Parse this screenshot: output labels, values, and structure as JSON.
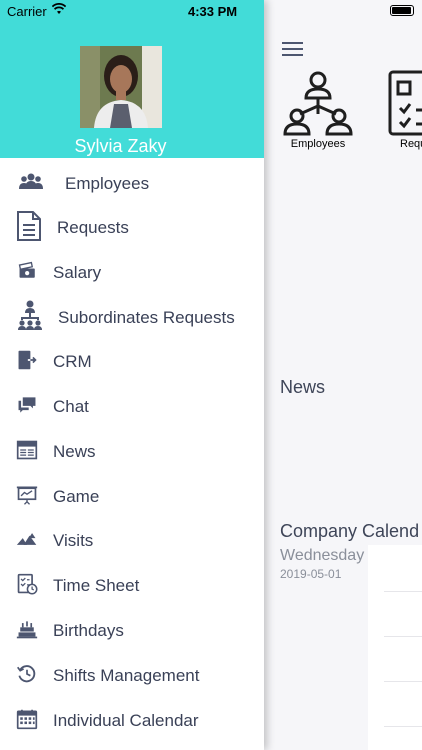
{
  "status_bar": {
    "carrier": "Carrier",
    "time": "4:33 PM"
  },
  "drawer": {
    "user_name": "Sylvia Zaky",
    "items": [
      {
        "label": "Employees",
        "icon": "employees-icon"
      },
      {
        "label": "Requests",
        "icon": "document-icon"
      },
      {
        "label": "Salary",
        "icon": "salary-icon"
      },
      {
        "label": "Subordinates Requests",
        "icon": "hierarchy-icon"
      },
      {
        "label": "CRM",
        "icon": "crm-icon"
      },
      {
        "label": "Chat",
        "icon": "chat-icon"
      },
      {
        "label": "News",
        "icon": "newspaper-icon"
      },
      {
        "label": "Game",
        "icon": "presentation-icon"
      },
      {
        "label": "Visits",
        "icon": "visits-icon"
      },
      {
        "label": "Time Sheet",
        "icon": "timesheet-icon"
      },
      {
        "label": "Birthdays",
        "icon": "cake-icon"
      },
      {
        "label": "Shifts Management",
        "icon": "shift-clock-icon"
      },
      {
        "label": "Individual Calendar",
        "icon": "calendar-icon"
      }
    ]
  },
  "main": {
    "tiles": [
      {
        "label": "Employees"
      },
      {
        "label": "Requ"
      }
    ],
    "news_heading": "News",
    "calendar": {
      "heading": "Company Calend",
      "day": "Wednesday",
      "date": "2019-05-01"
    }
  },
  "colors": {
    "header": "#42dcd8",
    "icon": "#4d5670",
    "text": "#3a4157"
  }
}
